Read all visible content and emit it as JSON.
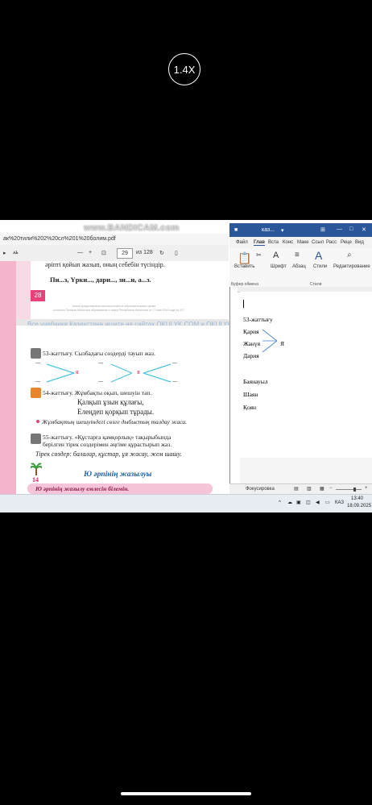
{
  "player": {
    "speed_label": "1.4X"
  },
  "watermark": "www.BANDICAM.com",
  "pdf": {
    "url_text": "ак%20тили%202%20сл%201%20болим.pdf",
    "toolbar": {
      "minus": "—",
      "plus": "+",
      "page_current": "29",
      "page_total": "из 128"
    },
    "page1": {
      "line1": "әріпті қойып жазып, оның себебін түсіндір.",
      "line2": "Пи...з, Үрки..., дари..., зи...н, а...з.",
      "page_number": "28",
      "footer_line1": "Книга предоставлена исключительно в образовательных целях",
      "footer_line2": "согласно Приказа Министра образования и науки Республики Казахстан от 17 мая 2019 года № 217"
    },
    "okulyk_banner": "Все учебники Казахстана ищите на сайтах OKULYK.COM и OKULYK.KZ",
    "page2": {
      "ex53": "53-жаттығу. Сызбадағы сөздерді тауып жаз.",
      "dots": "...",
      "ya": "я",
      "ex54": "54-жаттығу. Жұмбақты оқып, шешуін тап.",
      "riddle1": "Қалқып ұзын құлағы,",
      "riddle2": "Елеңдеп қорқып тұрады.",
      "bullet_task": "Жұмбақтың шешуіндегі сөзге дыбыстық талдау жаса.",
      "ex55_a": "55-жаттығу. «Құстарға қамқорлық» тақырыбында",
      "ex55_b": "берілген тірек сөздерімен әңгіме құрастырып жаз.",
      "support_words": "Тірек сөздер: балалар, құстар, ұя жасау, жем шашу.",
      "lesson_num": "14",
      "lesson_title": "Ю әрпінің жазылуы",
      "goal": "Ю әрпінің жазылу емлесін білемін."
    }
  },
  "word": {
    "title": "каз...",
    "tabs": [
      "Файл",
      "Глав",
      "Вста",
      "Конс",
      "Маке",
      "Ссыл",
      "Расс",
      "Реце",
      "Вид"
    ],
    "ribbon": {
      "paste": "Вставить",
      "font": "Шрифт",
      "paragraph": "Абзац",
      "styles": "Стили",
      "editing": "Редактирование",
      "clipboard_group": "Буфер обмена",
      "styles_group": "Стили"
    },
    "doc": {
      "heading": "53-жаттығу",
      "w1": "Қария",
      "w2": "Жанүя",
      "w3": "Дария",
      "ya": "Я",
      "list": [
        "Баянауыл",
        "Шаян",
        "Қоян"
      ]
    },
    "status": {
      "focus": "Фокусировка"
    }
  },
  "taskbar": {
    "lang": "КАЗ",
    "time": "13:40",
    "date": "18.09.2025"
  },
  "colors": {
    "pink": "#f3b4cc",
    "magenta": "#e8407a",
    "word_blue": "#2b579a"
  }
}
